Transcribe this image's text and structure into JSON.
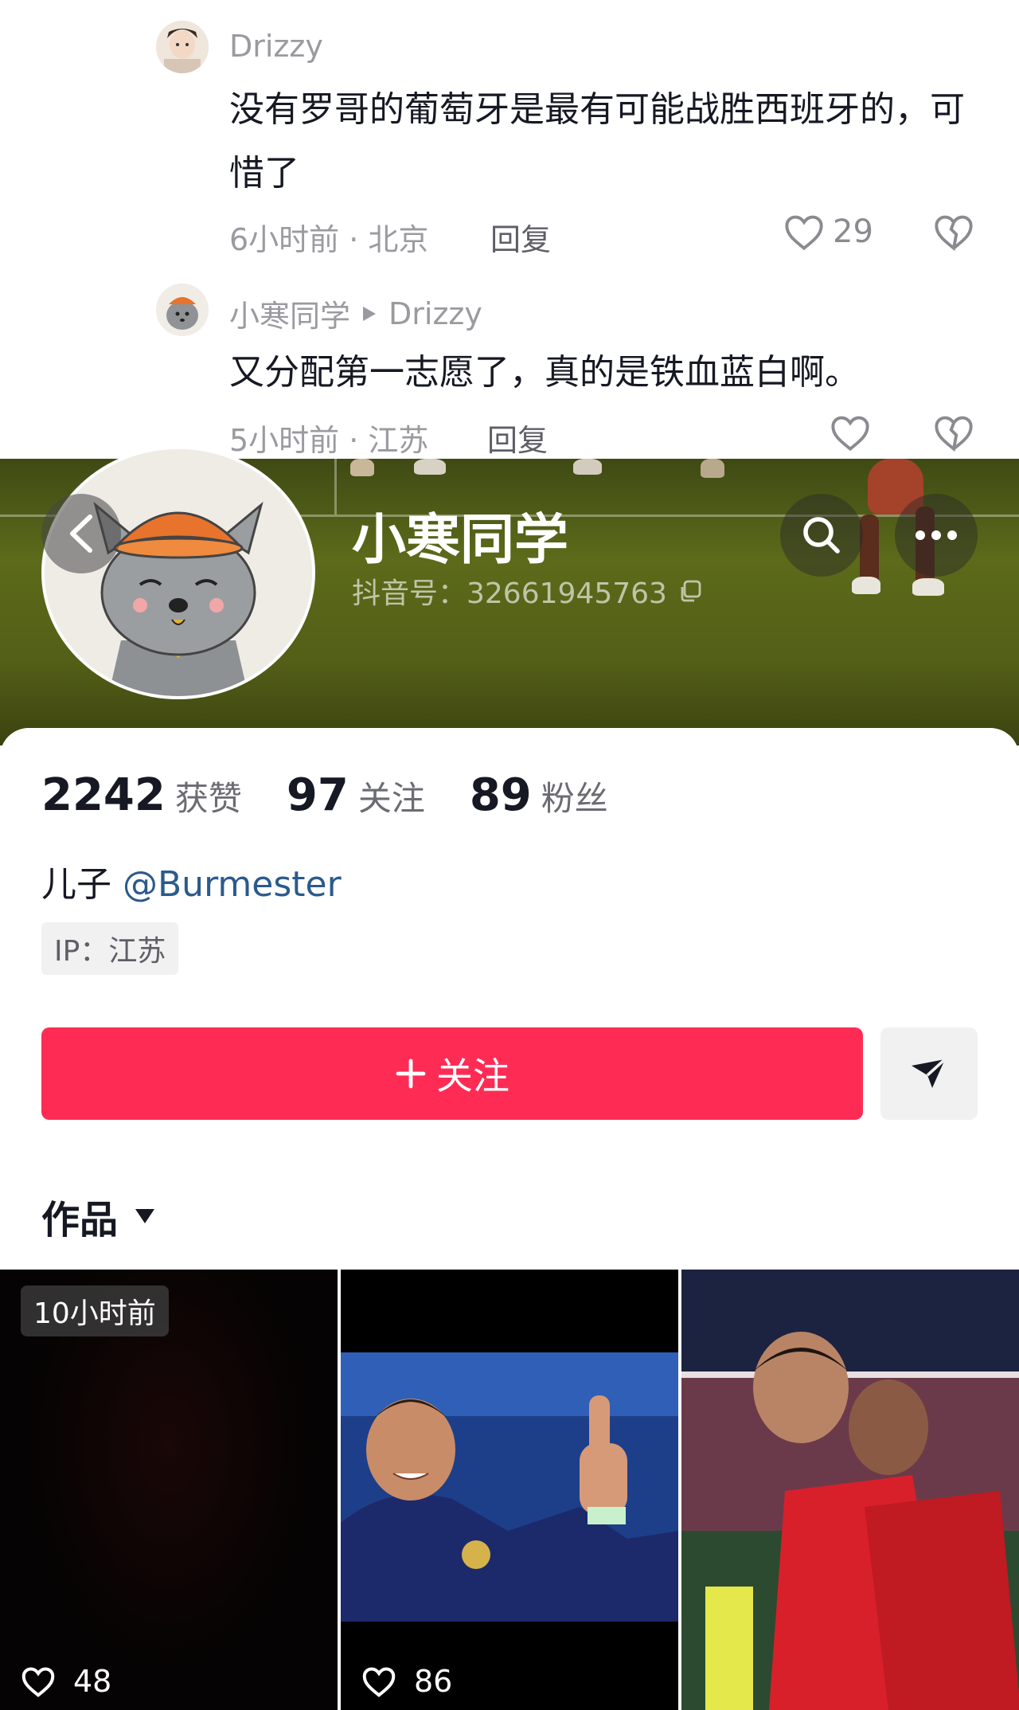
{
  "comments": [
    {
      "user": "Drizzy",
      "text": "没有罗哥的葡萄牙是最有可能战胜西班牙的，可惜了",
      "meta": "6小时前 · 北京",
      "reply_label": "回复",
      "likes": "29"
    },
    {
      "user": "小寒同学",
      "reply_to": "Drizzy",
      "text": "又分配第一志愿了，真的是铁血蓝白啊。",
      "meta": "5小时前 · 江苏",
      "reply_label": "回复",
      "likes": ""
    }
  ],
  "profile": {
    "name": "小寒同学",
    "douyin_id": "抖音号：32661945763",
    "stats": [
      {
        "value": "2242",
        "label": "获赞"
      },
      {
        "value": "97",
        "label": "关注"
      },
      {
        "value": "89",
        "label": "粉丝"
      }
    ],
    "bio_prefix": "儿子 ",
    "bio_mention": "@Burmester",
    "ip": "IP：江苏",
    "follow_label": "关注",
    "works_tab": "作品"
  },
  "videos": [
    {
      "badge": "10小时前",
      "likes": "48"
    },
    {
      "badge": "",
      "likes": "86"
    },
    {
      "badge": "",
      "likes": ""
    }
  ],
  "colors": {
    "accent": "#fe2c55",
    "mention": "#2b5a8c",
    "header_green": "#5c6a1a"
  },
  "icons": {
    "back": "chevron-left-icon",
    "search": "search-icon",
    "more": "more-dots-icon",
    "share": "share-arrow-icon",
    "like": "heart-icon",
    "dislike": "broken-heart-icon",
    "copy": "copy-icon",
    "dropdown": "triangle-down-icon"
  }
}
